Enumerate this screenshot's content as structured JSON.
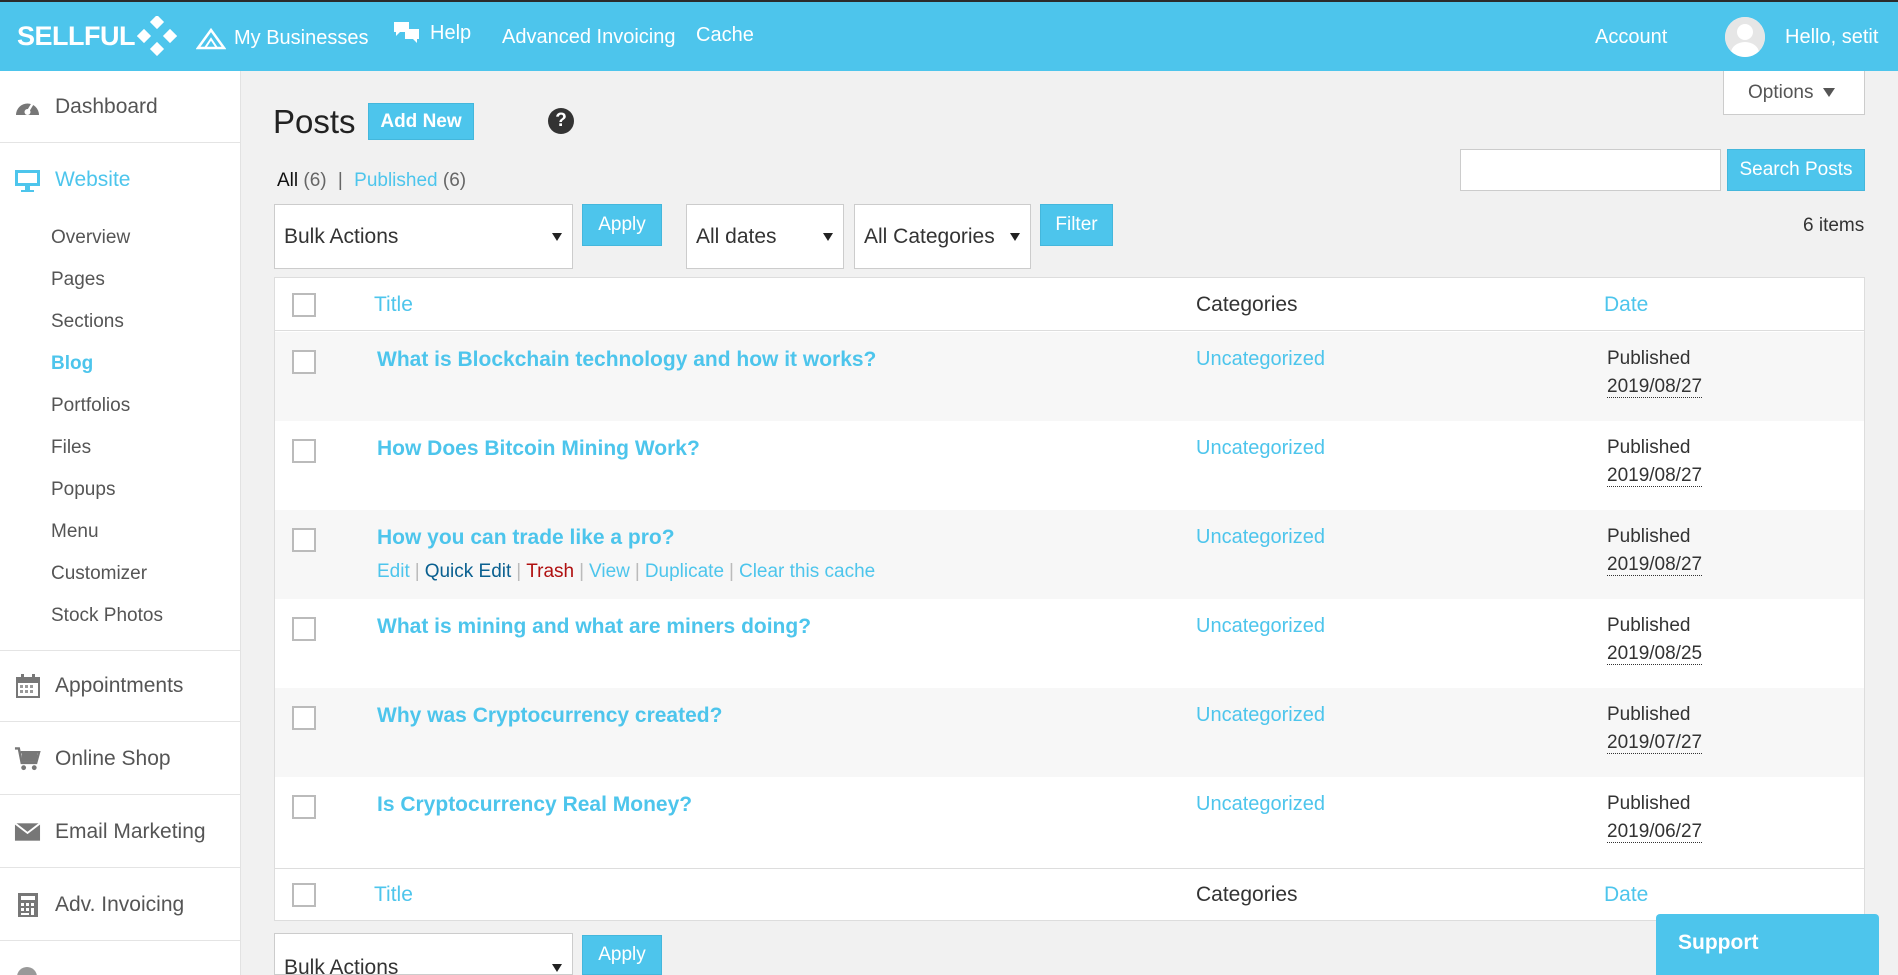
{
  "topbar": {
    "logo": "SELLFUL",
    "nav": [
      "My Businesses",
      "Help",
      "Advanced Invoicing",
      "Cache"
    ],
    "account": "Account",
    "greeting": "Hello, setit",
    "accent_color": "#4dc5ec"
  },
  "sidebar": {
    "sections": [
      {
        "label": "Dashboard",
        "icon": "dashboard-gauge-icon"
      },
      {
        "label": "Website",
        "icon": "monitor-icon",
        "active": true
      },
      {
        "label": "Appointments",
        "icon": "calendar-icon"
      },
      {
        "label": "Online Shop",
        "icon": "cart-icon"
      },
      {
        "label": "Email Marketing",
        "icon": "envelope-icon"
      },
      {
        "label": "Adv. Invoicing",
        "icon": "invoice-icon"
      }
    ],
    "website_items": [
      "Overview",
      "Pages",
      "Sections",
      "Blog",
      "Portfolios",
      "Files",
      "Popups",
      "Menu",
      "Customizer",
      "Stock Photos"
    ],
    "active_item": "Blog"
  },
  "page": {
    "title": "Posts",
    "add_new": "Add New",
    "options": "Options",
    "filters": {
      "all": "All",
      "all_count": "(6)",
      "published": "Published",
      "published_count": "(6)"
    },
    "search_button": "Search Posts",
    "search_value": "",
    "bulk_actions": "Bulk Actions",
    "apply": "Apply",
    "all_dates": "All dates",
    "all_categories": "All Categories",
    "filter": "Filter",
    "items_count": "6 items"
  },
  "table": {
    "columns": {
      "title": "Title",
      "categories": "Categories",
      "date": "Date"
    },
    "row_actions": [
      "Edit",
      "Quick Edit",
      "Trash",
      "View",
      "Duplicate",
      "Clear this cache"
    ],
    "rows": [
      {
        "title": "What is Blockchain technology and how it works?",
        "category": "Uncategorized",
        "status": "Published",
        "date": "2019/08/27"
      },
      {
        "title": "How Does Bitcoin Mining Work?",
        "category": "Uncategorized",
        "status": "Published",
        "date": "2019/08/27"
      },
      {
        "title": "How you can trade like a pro?",
        "category": "Uncategorized",
        "status": "Published",
        "date": "2019/08/27",
        "hovered": true
      },
      {
        "title": "What is mining and what are miners doing?",
        "category": "Uncategorized",
        "status": "Published",
        "date": "2019/08/25"
      },
      {
        "title": "Why was Cryptocurrency created?",
        "category": "Uncategorized",
        "status": "Published",
        "date": "2019/07/27"
      },
      {
        "title": "Is Cryptocurrency Real Money?",
        "category": "Uncategorized",
        "status": "Published",
        "date": "2019/06/27"
      }
    ]
  },
  "support": "Support"
}
